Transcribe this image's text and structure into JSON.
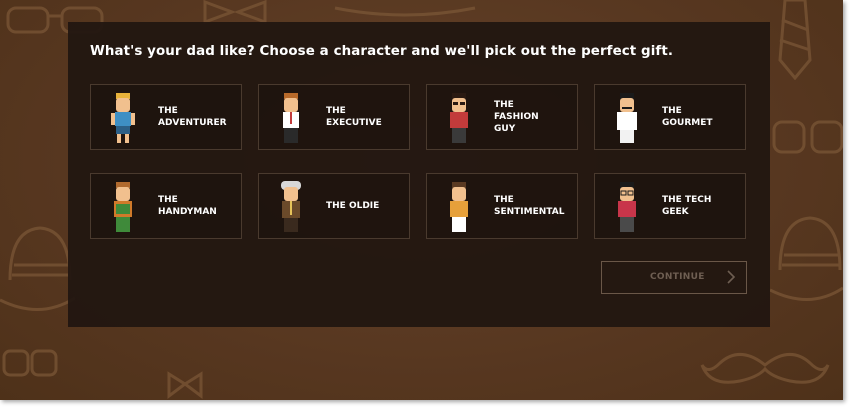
{
  "headline": "What's your dad like? Choose a character and we'll pick out the perfect gift.",
  "characters": [
    {
      "label": "THE\nADVENTURER",
      "icon": "adventurer-avatar-icon",
      "hair": "#e8b23a",
      "shirt": "#3e8fc4",
      "pants": "#2c5f86",
      "skin": "#f1c08e"
    },
    {
      "label": "THE\nEXECUTIVE",
      "icon": "executive-avatar-icon",
      "hair": "#b86a2a",
      "shirt": "#ffffff",
      "pants": "#2a2a2a",
      "skin": "#f1c08e"
    },
    {
      "label": "THE\nFASHION\nGUY",
      "icon": "fashion-guy-avatar-icon",
      "hair": "#2a1a12",
      "shirt": "#c23b3b",
      "pants": "#3a3a3a",
      "skin": "#f1c08e"
    },
    {
      "label": "THE\nGOURMET",
      "icon": "gourmet-avatar-icon",
      "hair": "#1a1a1a",
      "shirt": "#ffffff",
      "pants": "#f2f2f2",
      "skin": "#f1c08e"
    },
    {
      "label": "THE\nHANDYMAN",
      "icon": "handyman-avatar-icon",
      "hair": "#b06a2e",
      "shirt": "#d07a2a",
      "pants": "#3f8a3a",
      "skin": "#f1c08e"
    },
    {
      "label": "THE OLDIE",
      "icon": "oldie-avatar-icon",
      "hair": "#d8d8d8",
      "shirt": "#6b4a2a",
      "pants": "#3a2a1e",
      "skin": "#f1c08e"
    },
    {
      "label": "THE\nSENTIMENTAL",
      "icon": "sentimental-avatar-icon",
      "hair": "#5a3a22",
      "shirt": "#e6a03a",
      "pants": "#ffffff",
      "skin": "#f1c08e"
    },
    {
      "label": "THE TECH\nGEEK",
      "icon": "tech-geek-avatar-icon",
      "hair": "#1a1a1a",
      "shirt": "#c8354a",
      "pants": "#4a4a4a",
      "skin": "#f1c08e"
    }
  ],
  "continue_label": "CONTINUE",
  "continue_icon": "chevron-right-icon",
  "colors": {
    "background": "#5b3a20",
    "panel": "#201610",
    "card_border": "#4a3a2e",
    "continue_text": "#6e5e52"
  }
}
